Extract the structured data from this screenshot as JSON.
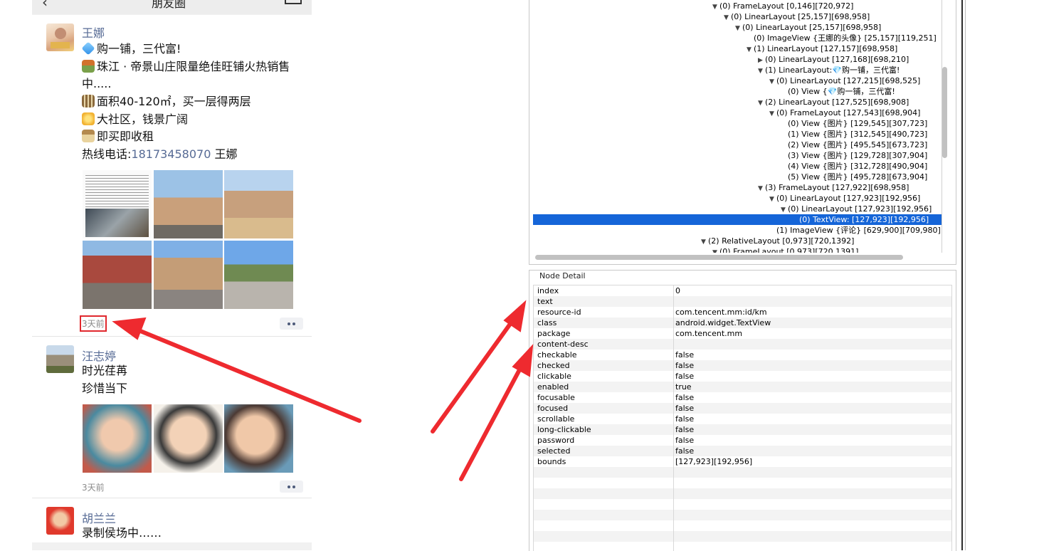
{
  "feed": {
    "title": "朋友圈",
    "posts": [
      {
        "name": "王娜",
        "lines": [
          "购一铺，三代富!",
          "珠江 · 帝景山庄限量绝佳旺铺火热销售",
          "中.....",
          "面积40-120㎡，买一层得两层",
          "大社区，钱景广阔",
          "即买即收租"
        ],
        "phone_prefix": "热线电话:",
        "phone": "18173458070",
        "phone_suffix": " 王娜",
        "time": "3天前"
      },
      {
        "name": "汪志婷",
        "lines": [
          "时光荏苒",
          "珍惜当下"
        ],
        "time": "3天前"
      },
      {
        "name": "胡兰兰",
        "lines": [
          "录制侯场中……"
        ]
      }
    ]
  },
  "tree": {
    "nodes": [
      "(0) FrameLayout [0,146][720,972]",
      "(0) LinearLayout [25,157][698,958]",
      "(0) LinearLayout [25,157][698,958]",
      "(0) ImageView {王娜的头像} [25,157][119,251]",
      "(1) LinearLayout [127,157][698,958]",
      "(0) LinearLayout [127,168][698,210]",
      "(1) LinearLayout:💎购一铺，三代富!",
      "(0) LinearLayout [127,215][698,525]",
      "(0) View {💎购一铺，三代富!",
      "(2) LinearLayout [127,525][698,908]",
      "(0) FrameLayout [127,543][698,904]",
      "(0) View {图片} [129,545][307,723]",
      "(1) View {图片} [312,545][490,723]",
      "(2) View {图片} [495,545][673,723]",
      "(3) View {图片} [129,728][307,904]",
      "(4) View {图片} [312,728][490,904]",
      "(5) View {图片} [495,728][673,904]",
      "(3) FrameLayout [127,922][698,958]",
      "(0) LinearLayout [127,923][192,956]",
      "(0) LinearLayout [127,923][192,956]",
      "(0) TextView: [127,923][192,956]",
      "(1) ImageView {评论} [629,900][709,980]",
      "(2) RelativeLayout [0,973][720,1392]",
      "(0) FrameLayout [0,973][720,1391]"
    ]
  },
  "detail": {
    "title": "Node Detail",
    "rows": [
      {
        "key": "index",
        "value": "0"
      },
      {
        "key": "text",
        "value": ""
      },
      {
        "key": "resource-id",
        "value": "com.tencent.mm:id/km"
      },
      {
        "key": "class",
        "value": "android.widget.TextView"
      },
      {
        "key": "package",
        "value": "com.tencent.mm"
      },
      {
        "key": "content-desc",
        "value": ""
      },
      {
        "key": "checkable",
        "value": "false"
      },
      {
        "key": "checked",
        "value": "false"
      },
      {
        "key": "clickable",
        "value": "false"
      },
      {
        "key": "enabled",
        "value": "true"
      },
      {
        "key": "focusable",
        "value": "false"
      },
      {
        "key": "focused",
        "value": "false"
      },
      {
        "key": "scrollable",
        "value": "false"
      },
      {
        "key": "long-clickable",
        "value": "false"
      },
      {
        "key": "password",
        "value": "false"
      },
      {
        "key": "selected",
        "value": "false"
      },
      {
        "key": "bounds",
        "value": "[127,923][192,956]"
      }
    ]
  },
  "colors": {
    "highlight": "#1565d8",
    "annotation": "#ee2a2f",
    "link": "#576b95"
  }
}
